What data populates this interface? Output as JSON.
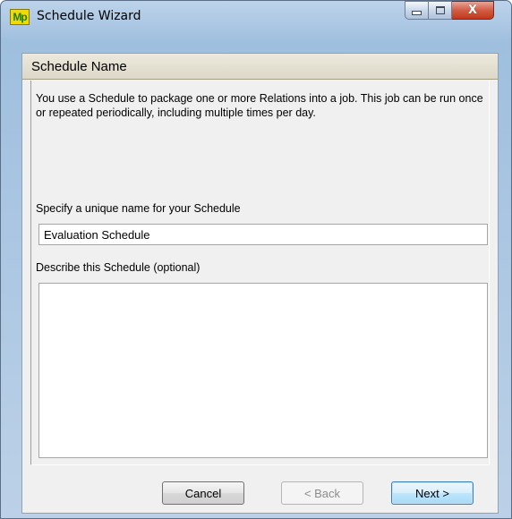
{
  "window": {
    "title": "Schedule Wizard",
    "app_icon_text": "Mp",
    "icon": "app-logo-icon",
    "caption_buttons": {
      "minimize_icon": "minimize-icon",
      "maximize_icon": "maximize-icon",
      "close_icon": "close-icon",
      "close_glyph": "X"
    }
  },
  "page": {
    "header_title": "Schedule Name",
    "intro_text": "You use a Schedule to package one or more Relations into a job. This job can be run once or repeated periodically, including multiple times per day.",
    "name_label": "Specify a unique name for your Schedule",
    "name_value": "Evaluation Schedule",
    "description_label": "Describe this Schedule (optional)",
    "description_value": ""
  },
  "buttons": {
    "cancel": "Cancel",
    "back": "< Back",
    "next": "Next >"
  },
  "colors": {
    "header_bar": "#e4e0d1",
    "accent_focus": "#3c7fb1",
    "close_button": "#c8432a",
    "app_icon_yellow": "#f2d900"
  }
}
